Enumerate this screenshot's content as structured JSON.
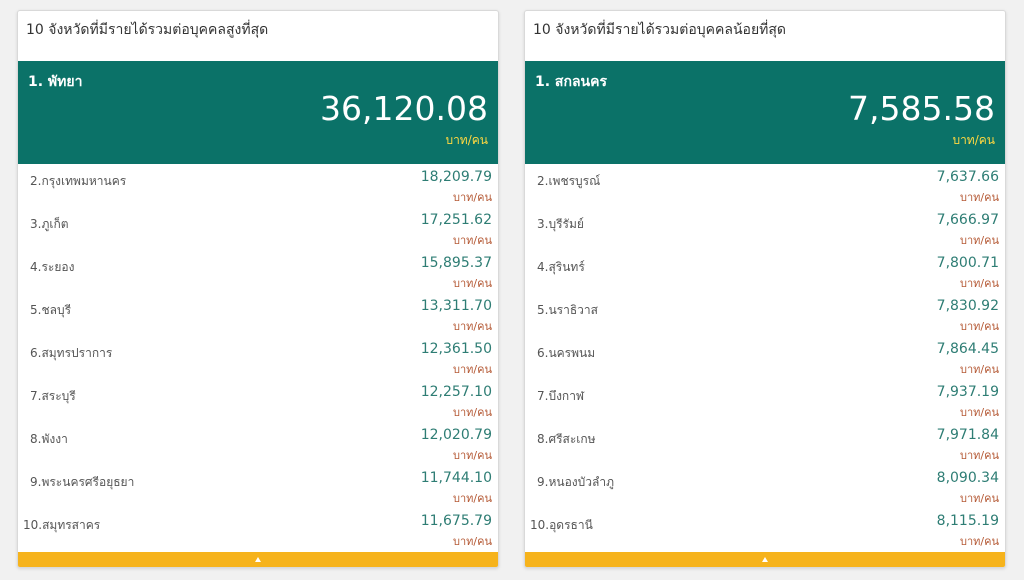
{
  "left_panel": {
    "title": "10 จังหวัดที่มีรายได้รวมต่อบุคคลสูงที่สุด",
    "top": {
      "name": "1. พัทยา",
      "value": "36,120.08",
      "unit": "บาท/คน"
    },
    "rows": [
      {
        "name": "2.กรุงเทพมหานคร",
        "value": "18,209.79",
        "unit": "บาท/คน"
      },
      {
        "name": "3.ภูเก็ต",
        "value": "17,251.62",
        "unit": "บาท/คน"
      },
      {
        "name": "4.ระยอง",
        "value": "15,895.37",
        "unit": "บาท/คน"
      },
      {
        "name": "5.ชลบุรี",
        "value": "13,311.70",
        "unit": "บาท/คน"
      },
      {
        "name": "6.สมุทรปราการ",
        "value": "12,361.50",
        "unit": "บาท/คน"
      },
      {
        "name": "7.สระบุรี",
        "value": "12,257.10",
        "unit": "บาท/คน"
      },
      {
        "name": "8.พังงา",
        "value": "12,020.79",
        "unit": "บาท/คน"
      },
      {
        "name": "9.พระนครศรีอยุธยา",
        "value": "11,744.10",
        "unit": "บาท/คน"
      },
      {
        "name": "10.สมุทรสาคร",
        "value": "11,675.79",
        "unit": "บาท/คน"
      }
    ]
  },
  "right_panel": {
    "title": "10 จังหวัดที่มีรายได้รวมต่อบุคคลน้อยที่สุด",
    "top": {
      "name": "1. สกลนคร",
      "value": "7,585.58",
      "unit": "บาท/คน"
    },
    "rows": [
      {
        "name": "2.เพชรบูรณ์",
        "value": "7,637.66",
        "unit": "บาท/คน"
      },
      {
        "name": "3.บุรีรัมย์",
        "value": "7,666.97",
        "unit": "บาท/คน"
      },
      {
        "name": "4.สุรินทร์",
        "value": "7,800.71",
        "unit": "บาท/คน"
      },
      {
        "name": "5.นราธิวาส",
        "value": "7,830.92",
        "unit": "บาท/คน"
      },
      {
        "name": "6.นครพนม",
        "value": "7,864.45",
        "unit": "บาท/คน"
      },
      {
        "name": "7.บึงกาฬ",
        "value": "7,937.19",
        "unit": "บาท/คน"
      },
      {
        "name": "8.ศรีสะเกษ",
        "value": "7,971.84",
        "unit": "บาท/คน"
      },
      {
        "name": "9.หนองบัวลำภู",
        "value": "8,090.34",
        "unit": "บาท/คน"
      },
      {
        "name": "10.อุดรธานี",
        "value": "8,115.19",
        "unit": "บาท/คน"
      }
    ]
  },
  "colors": {
    "top_block": "#0b7268",
    "top_unit": "#ffd840",
    "row_value": "#2e7d74",
    "row_unit": "#b55a36",
    "footer": "#f6b31c"
  },
  "footer_icon": "caret-up-icon"
}
